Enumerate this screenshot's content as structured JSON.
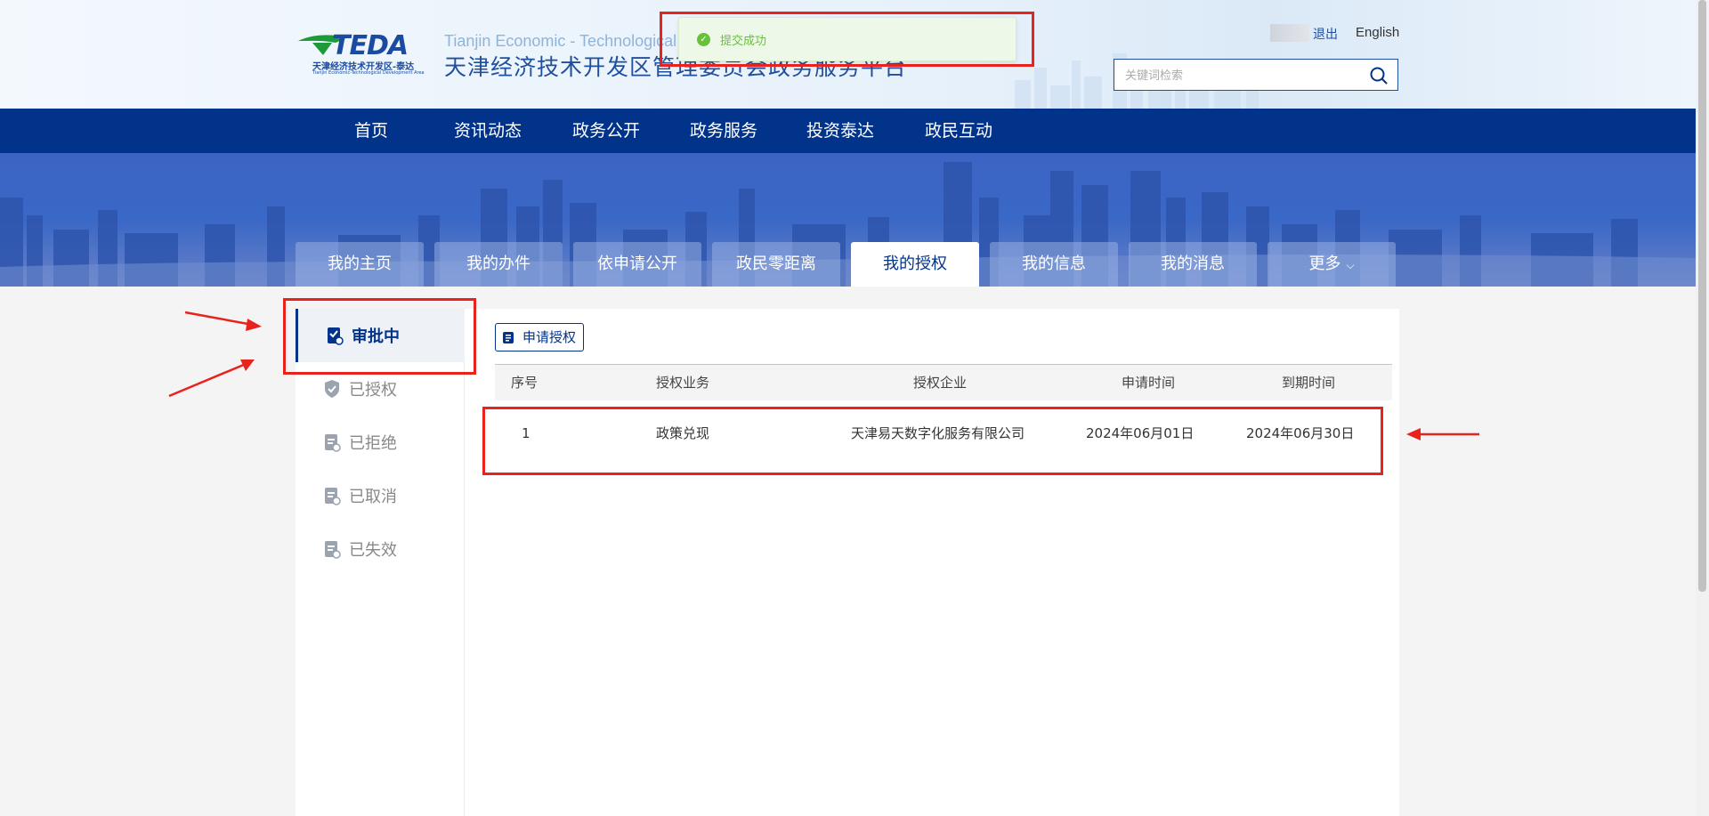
{
  "header": {
    "logo_text": "TEDA",
    "logo_cn": "天津经济技术开发区-泰达",
    "logo_en": "Tianjin Economic-Technological Development Area",
    "site_title_en": "Tianjin Economic - Technological",
    "site_title_cn": "天津经济技术开发区管理委员会政务服务平台",
    "logout": "退出",
    "english": "English",
    "search_placeholder": "关键词检索"
  },
  "toast": {
    "message": "提交成功",
    "color": "#67c23a"
  },
  "nav": {
    "items": [
      "首页",
      "资讯动态",
      "政务公开",
      "政务服务",
      "投资泰达",
      "政民互动"
    ]
  },
  "tabs": {
    "items": [
      "我的主页",
      "我的办件",
      "依申请公开",
      "政民零距离",
      "我的授权",
      "我的信息",
      "我的消息",
      "更多"
    ],
    "active": "我的授权"
  },
  "sidebar": {
    "items": [
      {
        "label": "审批中",
        "icon": "clipboard-check-icon"
      },
      {
        "label": "已授权",
        "icon": "shield-check-icon"
      },
      {
        "label": "已拒绝",
        "icon": "doc-reject-icon"
      },
      {
        "label": "已取消",
        "icon": "doc-cancel-icon"
      },
      {
        "label": "已失效",
        "icon": "doc-expired-icon"
      }
    ],
    "active": "审批中"
  },
  "main": {
    "apply_button": "申请授权",
    "columns": [
      "序号",
      "授权业务",
      "授权企业",
      "申请时间",
      "到期时间"
    ],
    "rows": [
      [
        "1",
        "政策兑现",
        "天津易天数字化服务有限公司",
        "2024年06月01日",
        "2024年06月30日"
      ]
    ]
  },
  "colors": {
    "primary": "#02338b",
    "annotation": "#e8221d"
  }
}
